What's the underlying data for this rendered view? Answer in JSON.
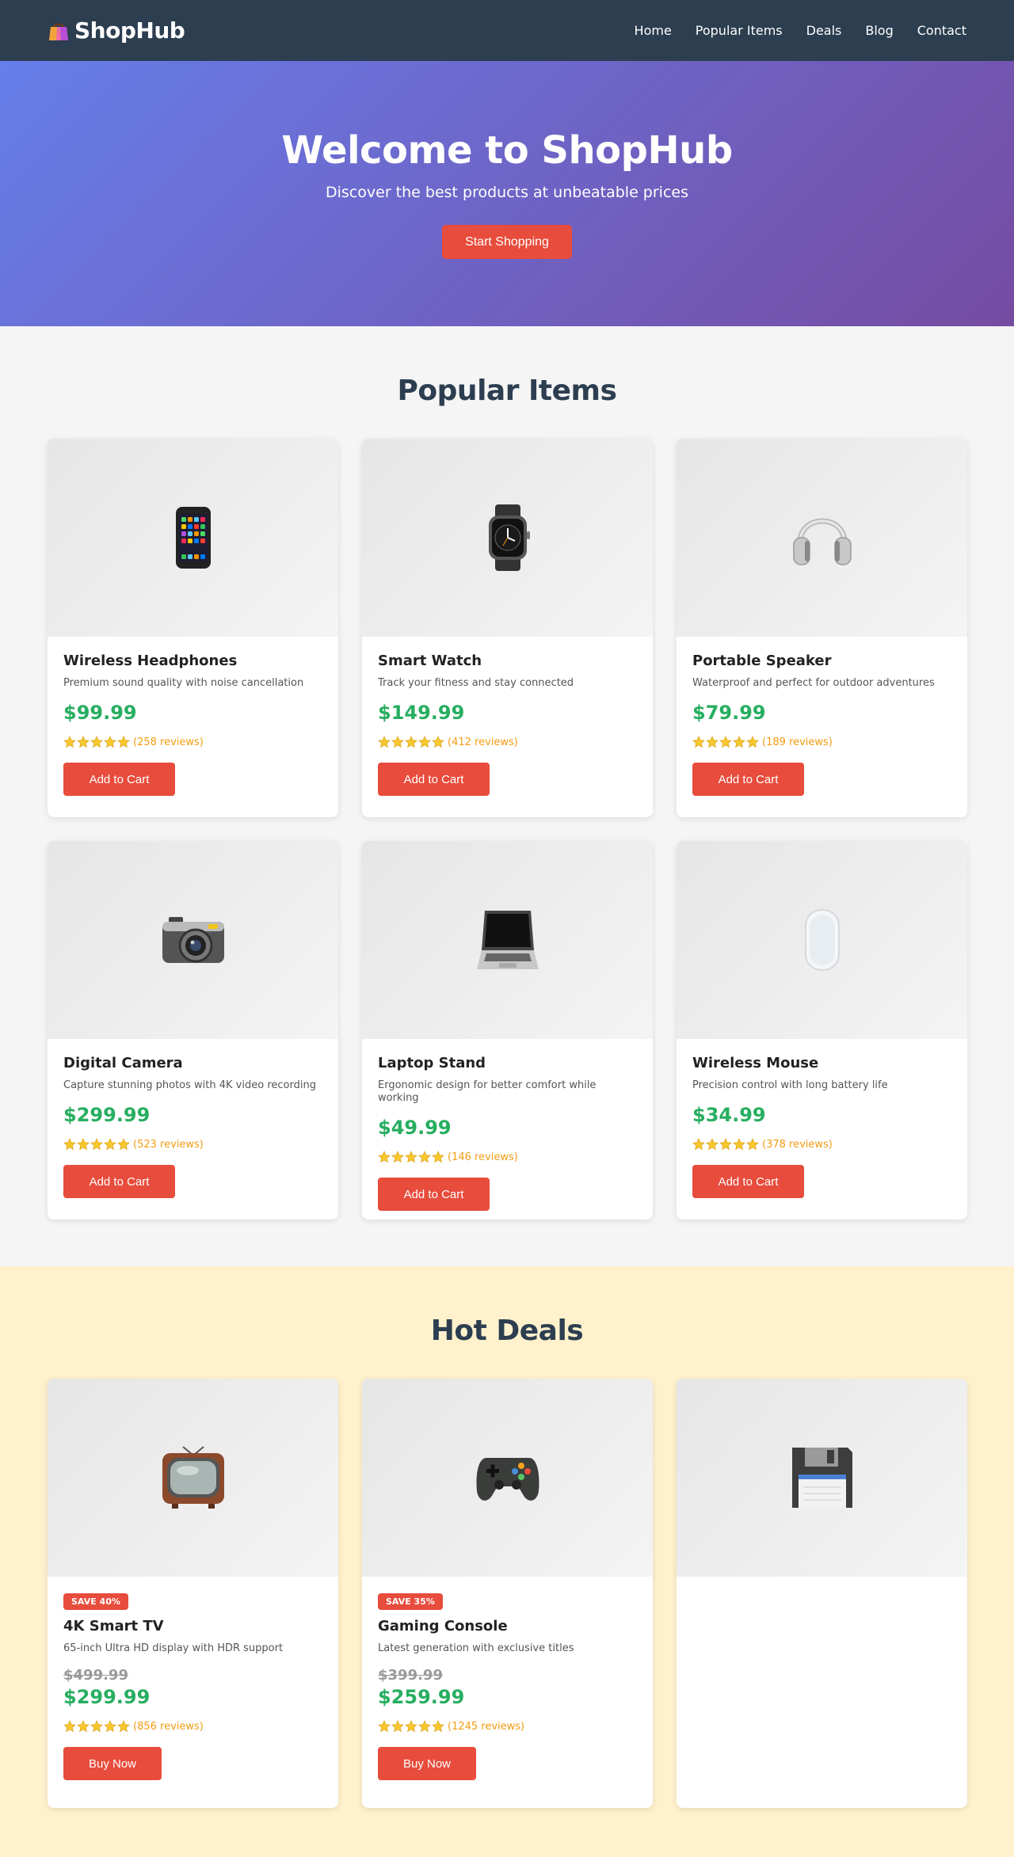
{
  "nav": {
    "brand": "ShopHub",
    "links": [
      "Home",
      "Popular Items",
      "Deals",
      "Blog",
      "Contact"
    ]
  },
  "hero": {
    "title": "Welcome to ShopHub",
    "subtitle": "Discover the best products at unbeatable prices",
    "cta": "Start Shopping"
  },
  "popular": {
    "title": "Popular Items",
    "items": [
      {
        "icon": "smartphone-icon",
        "name": "Wireless Headphones",
        "desc": "Premium sound quality with noise cancellation",
        "price": "$99.99",
        "reviews": "(258 reviews)",
        "button": "Add to Cart"
      },
      {
        "icon": "smartwatch-icon",
        "name": "Smart Watch",
        "desc": "Track your fitness and stay connected",
        "price": "$149.99",
        "reviews": "(412 reviews)",
        "button": "Add to Cart"
      },
      {
        "icon": "headphones-icon",
        "name": "Portable Speaker",
        "desc": "Waterproof and perfect for outdoor adventures",
        "price": "$79.99",
        "reviews": "(189 reviews)",
        "button": "Add to Cart"
      },
      {
        "icon": "camera-icon",
        "name": "Digital Camera",
        "desc": "Capture stunning photos with 4K video recording",
        "price": "$299.99",
        "reviews": "(523 reviews)",
        "button": "Add to Cart"
      },
      {
        "icon": "laptop-icon",
        "name": "Laptop Stand",
        "desc": "Ergonomic design for better comfort while working",
        "price": "$49.99",
        "reviews": "(146 reviews)",
        "button": "Add to Cart"
      },
      {
        "icon": "mouse-icon",
        "name": "Wireless Mouse",
        "desc": "Precision control with long battery life",
        "price": "$34.99",
        "reviews": "(378 reviews)",
        "button": "Add to Cart"
      }
    ]
  },
  "deals": {
    "title": "Hot Deals",
    "items": [
      {
        "icon": "television-icon",
        "badge": "SAVE 40%",
        "name": "4K Smart TV",
        "desc": "65-inch Ultra HD display with HDR support",
        "old_price": "$499.99",
        "price": "$299.99",
        "reviews": "(856 reviews)",
        "button": "Buy Now"
      },
      {
        "icon": "gamepad-icon",
        "badge": "SAVE 35%",
        "name": "Gaming Console",
        "desc": "Latest generation with exclusive titles",
        "old_price": "$399.99",
        "price": "$259.99",
        "reviews": "(1245 reviews)",
        "button": "Buy Now"
      },
      {
        "icon": "floppy-disk-icon"
      }
    ]
  },
  "colors": {
    "nav_bg": "#2c3e50",
    "accent": "#e74c3c",
    "price": "#27ae60",
    "rating": "#f39c12",
    "deals_bg": "#fff1cc"
  }
}
